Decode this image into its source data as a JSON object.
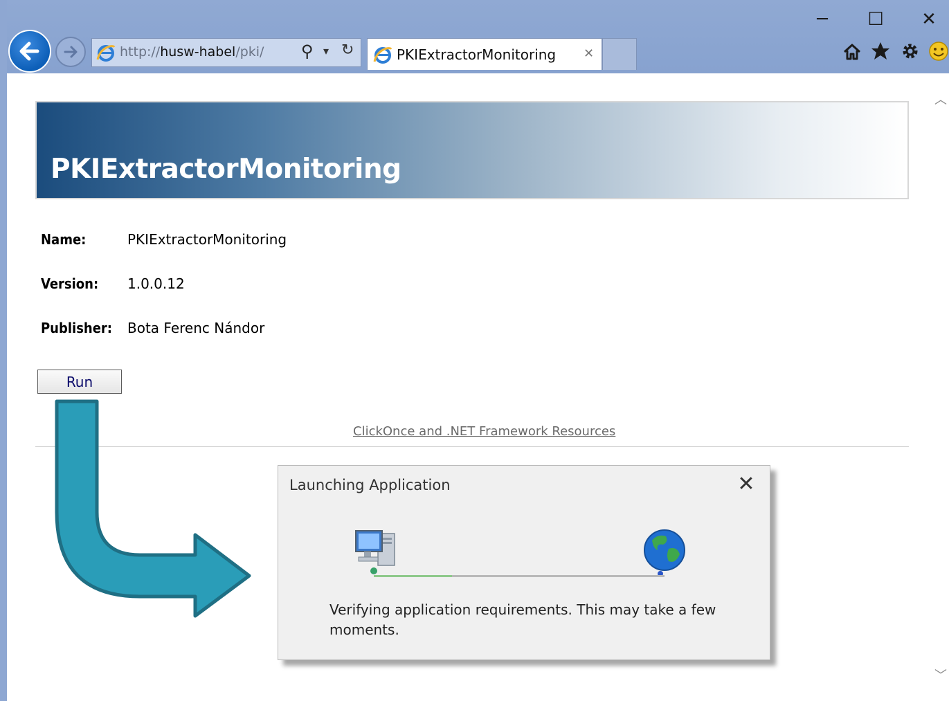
{
  "window": {
    "controls": {
      "minimize": "─",
      "maximize": "☐",
      "close": "✕"
    }
  },
  "navigation": {
    "address": {
      "scheme": "http://",
      "host": "husw-habel",
      "path": "/pki/"
    },
    "search_glyph": "⚲",
    "dropdown_glyph": "▾",
    "refresh_glyph": "↻",
    "tab_title": "PKIExtractorMonitoring",
    "tab_close": "✕",
    "toolbar_icons": [
      "home-icon",
      "favorites-star-icon",
      "settings-gear-icon",
      "smiley-feedback-icon"
    ]
  },
  "page": {
    "banner_title": "PKIExtractorMonitoring",
    "fields": [
      {
        "label": "Name:",
        "value": "PKIExtractorMonitoring"
      },
      {
        "label": "Version:",
        "value": "1.0.0.12"
      },
      {
        "label": "Publisher:",
        "value": "Bota Ferenc Nándor"
      }
    ],
    "run_button": "Run",
    "resources_link": "ClickOnce and .NET Framework Resources"
  },
  "dialog": {
    "title": "Launching Application",
    "close": "✕",
    "message": "Verifying application requirements. This may take a few moments.",
    "progress": 0.27,
    "icons": [
      "computer-icon",
      "globe-icon"
    ]
  },
  "colors": {
    "arrow_fill": "#2a9db8",
    "arrow_stroke": "#1f6f84",
    "titlebar": "#8ea7d2",
    "progress_fill": "#8ec98a"
  }
}
